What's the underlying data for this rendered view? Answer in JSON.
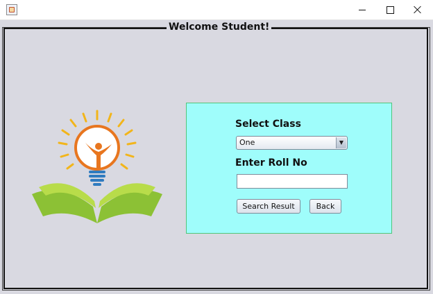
{
  "window": {
    "title": "",
    "icon": "java-app-icon",
    "controls": [
      "minimize-icon",
      "maximize-icon",
      "close-icon"
    ]
  },
  "frame": {
    "title": "Welcome Student!"
  },
  "logo": {
    "icon": "lightbulb-book-logo"
  },
  "form": {
    "class_label": "Select Class",
    "class_selected": "One",
    "roll_label": "Enter Roll No",
    "roll_value": "",
    "search_button": "Search Result",
    "back_button": "Back"
  },
  "colors": {
    "background": "#d9d9e1",
    "panel": "#9ffdfb",
    "panel_border": "#52c478",
    "logo_orange": "#e8761f",
    "logo_yellow": "#f2b51a",
    "logo_green": "#9ccc38",
    "logo_blue": "#2f7bbf"
  }
}
